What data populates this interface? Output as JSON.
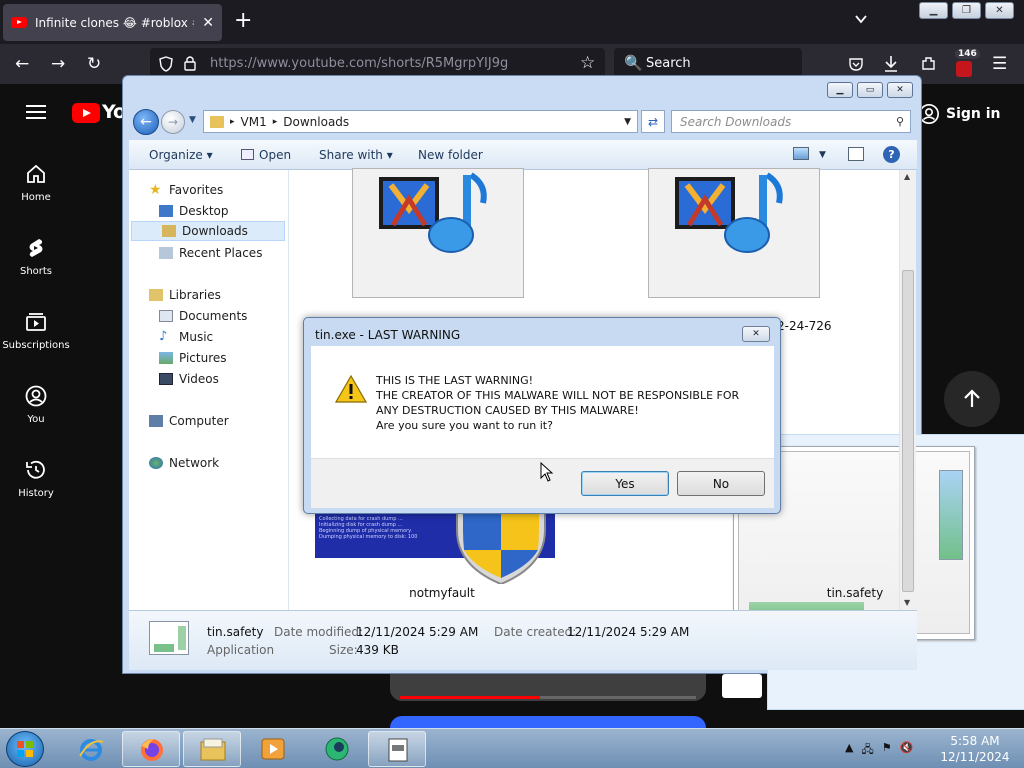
{
  "firefox": {
    "tab_title": "Infinite clones 😂 #roblox #roblox",
    "url": "https://www.youtube.com/shorts/R5MgrpYIJ9g",
    "search_label": "Search",
    "extension_badge": "146"
  },
  "youtube": {
    "logo_text": "Yo",
    "sign_in": "Sign in",
    "sidebar": [
      {
        "label": "Home",
        "icon": "home-icon"
      },
      {
        "label": "Shorts",
        "icon": "shorts-icon"
      },
      {
        "label": "Subscriptions",
        "icon": "subscriptions-icon"
      },
      {
        "label": "You",
        "icon": "you-icon"
      },
      {
        "label": "History",
        "icon": "history-icon"
      }
    ],
    "accent": "#ff0000"
  },
  "explorer": {
    "breadcrumb": [
      "VM1",
      "Downloads"
    ],
    "search_placeholder": "Search Downloads",
    "toolbar": {
      "organize": "Organize",
      "open": "Open",
      "share_with": "Share with",
      "new_folder": "New folder"
    },
    "nav": {
      "favorites": "Favorites",
      "desktop": "Desktop",
      "downloads": "Downloads",
      "recent_places": "Recent Places",
      "libraries": "Libraries",
      "documents": "Documents",
      "music": "Music",
      "pictures": "Pictures",
      "videos": "Videos",
      "computer": "Computer",
      "network": "Network"
    },
    "files": {
      "partial_label": "2-24-726",
      "notmyfault": "notmyfault",
      "tin_safety": "tin.safety"
    },
    "details": {
      "name": "tin.safety",
      "type": "Application",
      "modified_label": "Date modified:",
      "modified_value": "12/11/2024 5:29 AM",
      "created_label": "Date created:",
      "created_value": "12/11/2024 5:29 AM",
      "size_label": "Size:",
      "size_value": "439 KB"
    }
  },
  "dialog": {
    "title": "tin.exe - LAST WARNING",
    "lines": [
      "THIS IS THE LAST WARNING!",
      "THE CREATOR OF THIS MALWARE WILL NOT BE RESPONSIBLE FOR",
      "ANY DESTRUCTION CAUSED BY THIS MALWARE!",
      "Are you sure you want to run it?"
    ],
    "yes": "Yes",
    "no": "No"
  },
  "taskbar": {
    "time": "5:58 AM",
    "date": "12/11/2024"
  }
}
